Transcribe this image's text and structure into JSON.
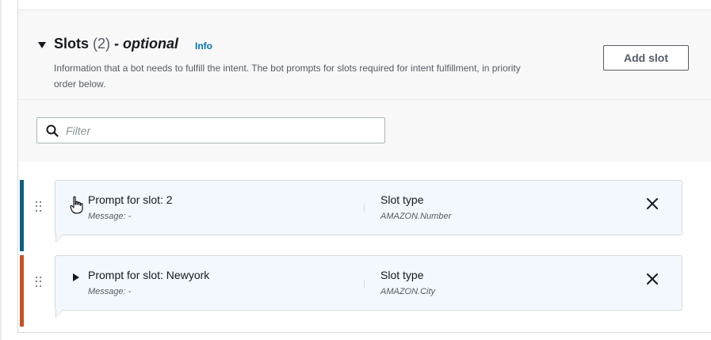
{
  "section": {
    "title": "Slots",
    "count": "(2)",
    "optional": "- optional",
    "info": "Info",
    "description": "Information that a bot needs to fulfill the intent. The bot prompts for slots required for intent fulfillment, in priority order below.",
    "add_button": "Add slot"
  },
  "filter": {
    "placeholder": "Filter",
    "value": ""
  },
  "slots": [
    {
      "prompt": "Prompt for slot: 2",
      "message": "Message: -",
      "type_label": "Slot type",
      "type_value": "AMAZON.Number",
      "accent": "#0f5e7f"
    },
    {
      "prompt": "Prompt for slot: Newyork",
      "message": "Message: -",
      "type_label": "Slot type",
      "type_value": "AMAZON.City",
      "accent": "#c7511f"
    }
  ],
  "icons": {
    "collapse": "caret-down-icon",
    "search": "search-icon",
    "drag": "drag-handle-icon",
    "expand": "caret-right-icon",
    "remove": "close-icon",
    "cursor": "hand-cursor-icon"
  }
}
